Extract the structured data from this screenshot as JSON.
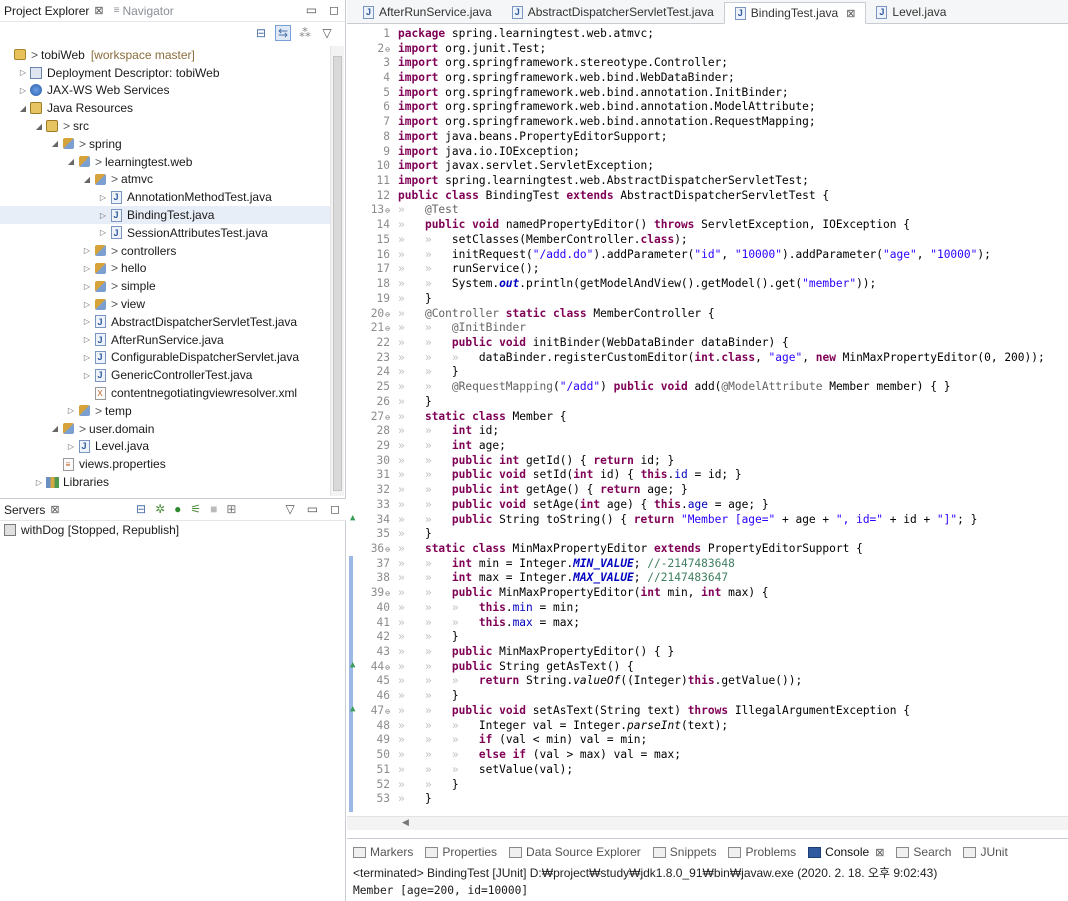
{
  "project_explorer": {
    "tab_label": "Project Explorer",
    "navigator_label": "Navigator",
    "tree": [
      {
        "depth": 0,
        "arrow": "",
        "icon": "project",
        "prefix": "> ",
        "label": "tobiWeb",
        "suffix": "[workspace master]"
      },
      {
        "depth": 1,
        "arrow": "▷",
        "icon": "deployment-descriptor",
        "prefix": "",
        "label": "Deployment Descriptor: tobiWeb",
        "suffix": ""
      },
      {
        "depth": 1,
        "arrow": "▷",
        "icon": "web-services",
        "prefix": "",
        "label": "JAX-WS Web Services",
        "suffix": ""
      },
      {
        "depth": 1,
        "arrow": "◢",
        "icon": "java-resources",
        "prefix": "",
        "label": "Java Resources",
        "suffix": ""
      },
      {
        "depth": 2,
        "arrow": "◢",
        "icon": "source-folder",
        "prefix": "> ",
        "label": "src",
        "suffix": ""
      },
      {
        "depth": 3,
        "arrow": "◢",
        "icon": "package",
        "prefix": "> ",
        "label": "spring",
        "suffix": ""
      },
      {
        "depth": 4,
        "arrow": "◢",
        "icon": "package",
        "prefix": "> ",
        "label": "learningtest.web",
        "suffix": ""
      },
      {
        "depth": 5,
        "arrow": "◢",
        "icon": "package",
        "prefix": "> ",
        "label": "atmvc",
        "suffix": ""
      },
      {
        "depth": 6,
        "arrow": "▷",
        "icon": "java-file",
        "prefix": "",
        "label": "AnnotationMethodTest.java",
        "suffix": ""
      },
      {
        "depth": 6,
        "arrow": "▷",
        "icon": "java-file",
        "prefix": "",
        "label": "BindingTest.java",
        "suffix": ""
      },
      {
        "depth": 6,
        "arrow": "▷",
        "icon": "java-file",
        "prefix": "",
        "label": "SessionAttributesTest.java",
        "suffix": ""
      },
      {
        "depth": 5,
        "arrow": "▷",
        "icon": "package",
        "prefix": "> ",
        "label": "controllers",
        "suffix": ""
      },
      {
        "depth": 5,
        "arrow": "▷",
        "icon": "package",
        "prefix": "> ",
        "label": "hello",
        "suffix": ""
      },
      {
        "depth": 5,
        "arrow": "▷",
        "icon": "package",
        "prefix": "> ",
        "label": "simple",
        "suffix": ""
      },
      {
        "depth": 5,
        "arrow": "▷",
        "icon": "package",
        "prefix": "> ",
        "label": "view",
        "suffix": ""
      },
      {
        "depth": 5,
        "arrow": "▷",
        "icon": "java-file",
        "prefix": "",
        "label": "AbstractDispatcherServletTest.java",
        "suffix": ""
      },
      {
        "depth": 5,
        "arrow": "▷",
        "icon": "java-file",
        "prefix": "",
        "label": "AfterRunService.java",
        "suffix": ""
      },
      {
        "depth": 5,
        "arrow": "▷",
        "icon": "java-file",
        "prefix": "",
        "label": "ConfigurableDispatcherServlet.java",
        "suffix": ""
      },
      {
        "depth": 5,
        "arrow": "▷",
        "icon": "java-file",
        "prefix": "",
        "label": "GenericControllerTest.java",
        "suffix": ""
      },
      {
        "depth": 5,
        "arrow": "",
        "icon": "xml-file",
        "prefix": "",
        "label": "contentnegotiatingviewresolver.xml",
        "suffix": ""
      },
      {
        "depth": 4,
        "arrow": "▷",
        "icon": "package",
        "prefix": "> ",
        "label": "temp",
        "suffix": ""
      },
      {
        "depth": 3,
        "arrow": "◢",
        "icon": "package",
        "prefix": "> ",
        "label": "user.domain",
        "suffix": ""
      },
      {
        "depth": 4,
        "arrow": "▷",
        "icon": "java-file",
        "prefix": "",
        "label": "Level.java",
        "suffix": ""
      },
      {
        "depth": 3,
        "arrow": "",
        "icon": "properties-file",
        "prefix": "",
        "label": "views.properties",
        "suffix": ""
      },
      {
        "depth": 2,
        "arrow": "▷",
        "icon": "libraries",
        "prefix": "",
        "label": "Libraries",
        "suffix": ""
      }
    ]
  },
  "servers": {
    "tab_label": "Servers",
    "items": [
      {
        "label": "withDog  [Stopped, Republish]"
      }
    ]
  },
  "editor": {
    "tabs": [
      {
        "label": "AfterRunService.java",
        "active": false
      },
      {
        "label": "AbstractDispatcherServletTest.java",
        "active": false
      },
      {
        "label": "BindingTest.java",
        "active": true
      },
      {
        "label": "Level.java",
        "active": false
      }
    ],
    "lines": [
      {
        "n": 1,
        "fold": "",
        "text": "package spring.learningtest.web.atmvc;"
      },
      {
        "n": 2,
        "fold": "⊖",
        "text": "import org.junit.Test;"
      },
      {
        "n": 3,
        "fold": "",
        "text": "import org.springframework.stereotype.Controller;"
      },
      {
        "n": 4,
        "fold": "",
        "text": "import org.springframework.web.bind.WebDataBinder;"
      },
      {
        "n": 5,
        "fold": "",
        "text": "import org.springframework.web.bind.annotation.InitBinder;"
      },
      {
        "n": 6,
        "fold": "",
        "text": "import org.springframework.web.bind.annotation.ModelAttribute;"
      },
      {
        "n": 7,
        "fold": "",
        "text": "import org.springframework.web.bind.annotation.RequestMapping;"
      },
      {
        "n": 8,
        "fold": "",
        "text": "import java.beans.PropertyEditorSupport;"
      },
      {
        "n": 9,
        "fold": "",
        "text": "import java.io.IOException;"
      },
      {
        "n": 10,
        "fold": "",
        "text": "import javax.servlet.ServletException;"
      },
      {
        "n": 11,
        "fold": "",
        "text": "import spring.learningtest.web.AbstractDispatcherServletTest;"
      },
      {
        "n": 12,
        "fold": "",
        "text": "public class BindingTest extends AbstractDispatcherServletTest {"
      },
      {
        "n": 13,
        "fold": "⊖",
        "text": "    @Test"
      },
      {
        "n": 14,
        "fold": "",
        "text": "    public void namedPropertyEditor() throws ServletException, IOException {"
      },
      {
        "n": 15,
        "fold": "",
        "text": "        setClasses(MemberController.class);"
      },
      {
        "n": 16,
        "fold": "",
        "text": "        initRequest(\"/add.do\").addParameter(\"id\", \"10000\").addParameter(\"age\", \"10000\");"
      },
      {
        "n": 17,
        "fold": "",
        "text": "        runService();"
      },
      {
        "n": 18,
        "fold": "",
        "text": "        System.out.println(getModelAndView().getModel().get(\"member\"));"
      },
      {
        "n": 19,
        "fold": "",
        "text": "    }"
      },
      {
        "n": 20,
        "fold": "⊖",
        "text": "    @Controller static class MemberController {"
      },
      {
        "n": 21,
        "fold": "⊖",
        "text": "        @InitBinder"
      },
      {
        "n": 22,
        "fold": "",
        "text": "        public void initBinder(WebDataBinder dataBinder) {"
      },
      {
        "n": 23,
        "fold": "",
        "text": "            dataBinder.registerCustomEditor(int.class, \"age\", new MinMaxPropertyEditor(0, 200));"
      },
      {
        "n": 24,
        "fold": "",
        "text": "        }"
      },
      {
        "n": 25,
        "fold": "",
        "text": "        @RequestMapping(\"/add\") public void add(@ModelAttribute Member member) { }"
      },
      {
        "n": 26,
        "fold": "",
        "text": "    }"
      },
      {
        "n": 27,
        "fold": "⊖",
        "text": "    static class Member {"
      },
      {
        "n": 28,
        "fold": "",
        "text": "        int id;"
      },
      {
        "n": 29,
        "fold": "",
        "text": "        int age;"
      },
      {
        "n": 30,
        "fold": "",
        "text": "        public int getId() { return id; }"
      },
      {
        "n": 31,
        "fold": "",
        "text": "        public void setId(int id) { this.id = id; }"
      },
      {
        "n": 32,
        "fold": "",
        "text": "        public int getAge() { return age; }"
      },
      {
        "n": 33,
        "fold": "",
        "text": "        public void setAge(int age) { this.age = age; }"
      },
      {
        "n": 34,
        "fold": "",
        "marker": "▲",
        "text": "        public String toString() { return \"Member [age=\" + age + \", id=\" + id + \"]\"; }"
      },
      {
        "n": 35,
        "fold": "",
        "text": "    }"
      },
      {
        "n": 36,
        "fold": "⊖",
        "text": "    static class MinMaxPropertyEditor extends PropertyEditorSupport {"
      },
      {
        "n": 37,
        "fold": "",
        "text": "        int min = Integer.MIN_VALUE; //-2147483648"
      },
      {
        "n": 38,
        "fold": "",
        "text": "        int max = Integer.MAX_VALUE; //2147483647"
      },
      {
        "n": 39,
        "fold": "⊖",
        "text": "        public MinMaxPropertyEditor(int min, int max) {"
      },
      {
        "n": 40,
        "fold": "",
        "text": "            this.min = min;"
      },
      {
        "n": 41,
        "fold": "",
        "text": "            this.max = max;"
      },
      {
        "n": 42,
        "fold": "",
        "text": "        }"
      },
      {
        "n": 43,
        "fold": "",
        "text": "        public MinMaxPropertyEditor() { }"
      },
      {
        "n": 44,
        "fold": "⊖",
        "marker": "▲",
        "text": "        public String getAsText() {"
      },
      {
        "n": 45,
        "fold": "",
        "text": "            return String.valueOf((Integer)this.getValue());"
      },
      {
        "n": 46,
        "fold": "",
        "text": "        }"
      },
      {
        "n": 47,
        "fold": "⊖",
        "marker": "▲",
        "text": "        public void setAsText(String text) throws IllegalArgumentException {"
      },
      {
        "n": 48,
        "fold": "",
        "text": "            Integer val = Integer.parseInt(text);"
      },
      {
        "n": 49,
        "fold": "",
        "text": "            if (val < min) val = min;"
      },
      {
        "n": 50,
        "fold": "",
        "text": "            else if (val > max) val = max;"
      },
      {
        "n": 51,
        "fold": "",
        "text": "            setValue(val);"
      },
      {
        "n": 52,
        "fold": "",
        "text": "        }"
      },
      {
        "n": 53,
        "fold": "",
        "text": "    }"
      }
    ]
  },
  "console": {
    "tabs": [
      {
        "label": "Markers",
        "icon": "markers-icon",
        "active": false
      },
      {
        "label": "Properties",
        "icon": "properties-icon",
        "active": false
      },
      {
        "label": "Data Source Explorer",
        "icon": "data-source-icon",
        "active": false
      },
      {
        "label": "Snippets",
        "icon": "snippets-icon",
        "active": false
      },
      {
        "label": "Problems",
        "icon": "problems-icon",
        "active": false
      },
      {
        "label": "Console",
        "icon": "console-icon",
        "active": true
      },
      {
        "label": "Search",
        "icon": "search-icon",
        "active": false
      },
      {
        "label": "JUnit",
        "icon": "junit-icon",
        "active": false
      }
    ],
    "status": "<terminated> BindingTest [JUnit] D:₩project₩study₩jdk1.8.0_91₩bin₩javaw.exe (2020. 2. 18. 오후 9:02:43)",
    "output": "Member [age=200, id=10000]"
  },
  "colors": {
    "keyword": "#7f0055",
    "string": "#2a00ff",
    "annotation": "#646464",
    "field": "#0000c0",
    "comment": "#3f7f5f"
  }
}
